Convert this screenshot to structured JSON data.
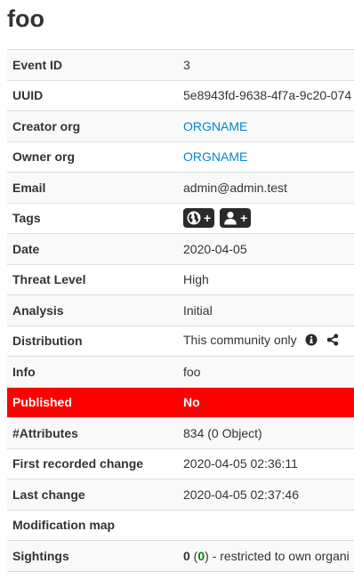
{
  "event": {
    "title": "foo"
  },
  "rows": {
    "event_id": {
      "label": "Event ID",
      "value": "3"
    },
    "uuid": {
      "label": "UUID",
      "value": "5e8943fd-9638-4f7a-9c20-074"
    },
    "creator_org": {
      "label": "Creator org",
      "value": "ORGNAME"
    },
    "owner_org": {
      "label": "Owner org",
      "value": "ORGNAME"
    },
    "email": {
      "label": "Email",
      "value": "admin@admin.test"
    },
    "tags": {
      "label": "Tags",
      "add_plus_1": "+",
      "add_plus_2": "+"
    },
    "date": {
      "label": "Date",
      "value": "2020-04-05"
    },
    "threat_level": {
      "label": "Threat Level",
      "value": "High"
    },
    "analysis": {
      "label": "Analysis",
      "value": "Initial"
    },
    "distribution": {
      "label": "Distribution",
      "value": "This community only"
    },
    "info": {
      "label": "Info",
      "value": "foo"
    },
    "published": {
      "label": "Published",
      "value": "No"
    },
    "attributes": {
      "label": "#Attributes",
      "value": "834 (0 Object)"
    },
    "first_recorded_change": {
      "label": "First recorded change",
      "value": "2020-04-05 02:36:11"
    },
    "last_change": {
      "label": "Last change",
      "value": "2020-04-05 02:37:46"
    },
    "modification_map": {
      "label": "Modification map",
      "value": ""
    },
    "sightings": {
      "label": "Sightings",
      "count": "0",
      "open_paren": " (",
      "positive": "0",
      "suffix": ") - restricted to own organi"
    }
  },
  "icons": {
    "tag_add_global": "globe-icon",
    "tag_add_local": "user-icon",
    "distribution_info": "info-circle-icon",
    "distribution_graph": "share-icon"
  },
  "colors": {
    "published_bg": "#ff0000",
    "link": "#0088cc",
    "sightings_green": "#008800",
    "tag_button_bg": "#2a2a2a"
  }
}
